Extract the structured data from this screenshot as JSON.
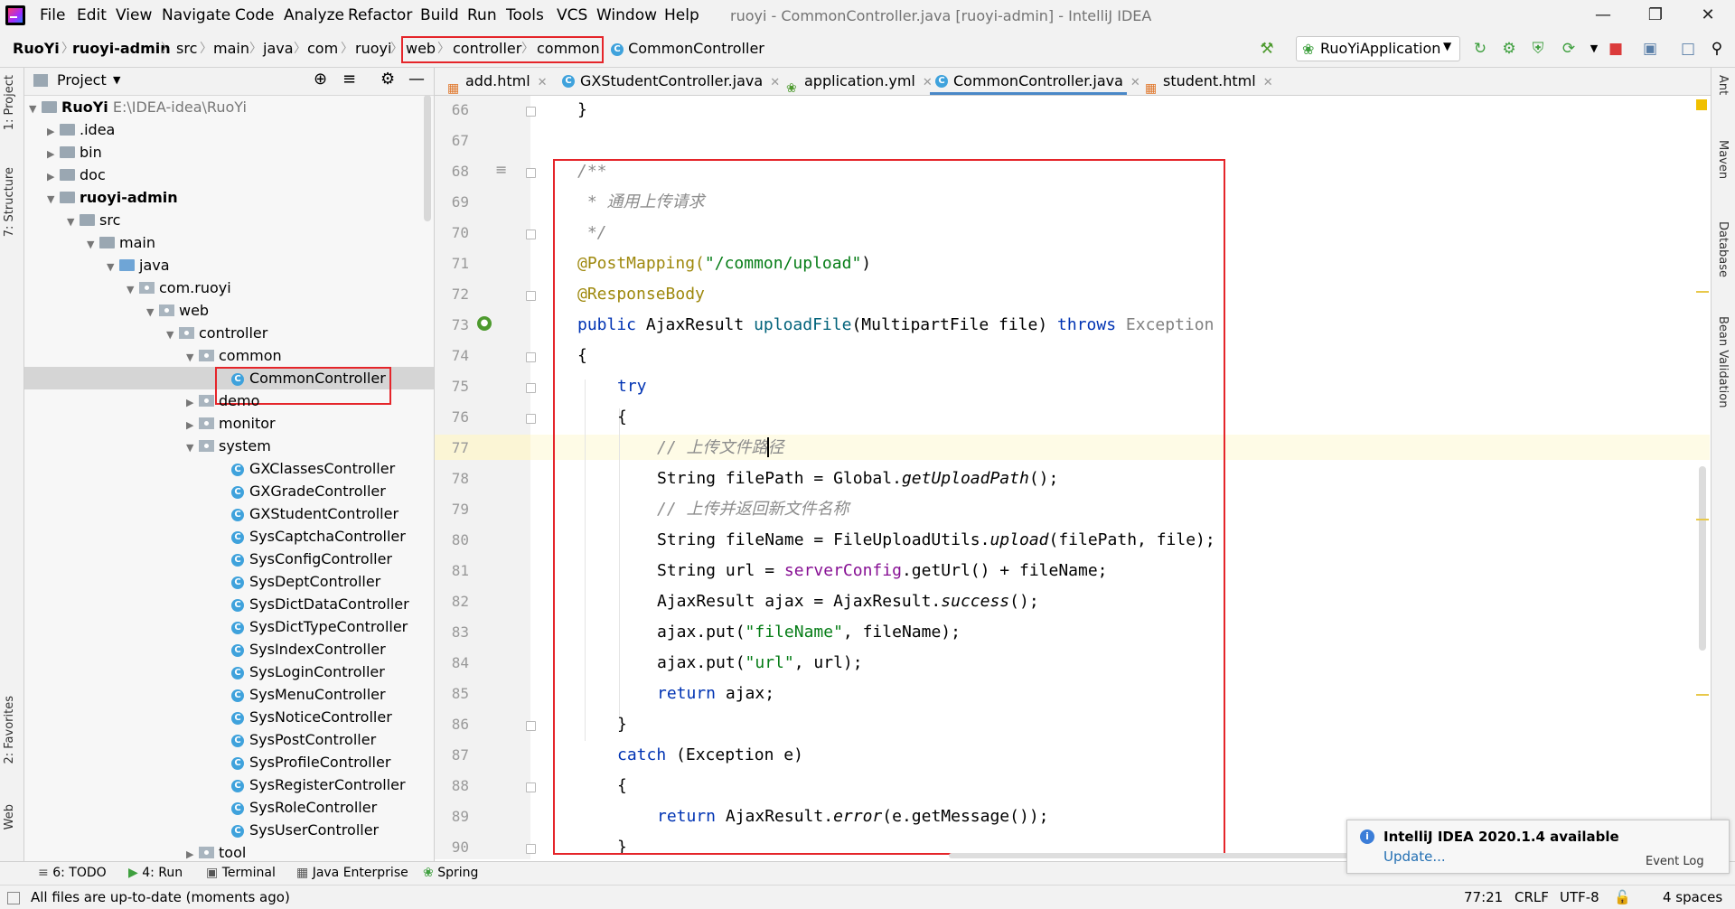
{
  "menu": [
    "File",
    "Edit",
    "View",
    "Navigate",
    "Code",
    "Analyze",
    "Refactor",
    "Build",
    "Run",
    "Tools",
    "VCS",
    "Window",
    "Help"
  ],
  "window_title": "ruoyi - CommonController.java [ruoyi-admin] - IntelliJ IDEA",
  "breadcrumbs": [
    "RuoYi",
    "ruoyi-admin",
    "src",
    "main",
    "java",
    "com",
    "ruoyi",
    "web",
    "controller",
    "common",
    "CommonController"
  ],
  "run_config": "RuoYiApplication",
  "project_panel": {
    "title": "Project"
  },
  "tree": [
    {
      "label": "RuoYi",
      "extra": "E:\\IDEA-idea\\RuoYi",
      "bold": true
    },
    {
      "label": ".idea"
    },
    {
      "label": "bin"
    },
    {
      "label": "doc"
    },
    {
      "label": "ruoyi-admin",
      "bold": true
    },
    {
      "label": "src"
    },
    {
      "label": "main"
    },
    {
      "label": "java"
    },
    {
      "label": "com.ruoyi"
    },
    {
      "label": "web"
    },
    {
      "label": "controller"
    },
    {
      "label": "common"
    },
    {
      "label": "CommonController"
    },
    {
      "label": "demo"
    },
    {
      "label": "monitor"
    },
    {
      "label": "system"
    },
    {
      "label": "GXClassesController"
    },
    {
      "label": "GXGradeController"
    },
    {
      "label": "GXStudentController"
    },
    {
      "label": "SysCaptchaController"
    },
    {
      "label": "SysConfigController"
    },
    {
      "label": "SysDeptController"
    },
    {
      "label": "SysDictDataController"
    },
    {
      "label": "SysDictTypeController"
    },
    {
      "label": "SysIndexController"
    },
    {
      "label": "SysLoginController"
    },
    {
      "label": "SysMenuController"
    },
    {
      "label": "SysNoticeController"
    },
    {
      "label": "SysPostController"
    },
    {
      "label": "SysProfileController"
    },
    {
      "label": "SysRegisterController"
    },
    {
      "label": "SysRoleController"
    },
    {
      "label": "SysUserController"
    },
    {
      "label": "tool"
    }
  ],
  "tabs": [
    "add.html",
    "GXStudentController.java",
    "application.yml",
    "CommonController.java",
    "student.html"
  ],
  "line_numbers": [
    "66",
    "67",
    "68",
    "69",
    "70",
    "71",
    "72",
    "73",
    "74",
    "75",
    "76",
    "77",
    "78",
    "79",
    "80",
    "81",
    "82",
    "83",
    "84",
    "85",
    "86",
    "87",
    "88",
    "89",
    "90"
  ],
  "code": {
    "l66": "}",
    "l68": "/**",
    "l69": " * 通用上传请求",
    "l70": " */",
    "l71a": "@PostMapping(",
    "l71b": "\"/common/upload\"",
    "l71c": ")",
    "l72": "@ResponseBody",
    "l73a": "public ",
    "l73b": "AjaxResult ",
    "l73c": "uploadFile",
    "l73d": "(MultipartFile file) ",
    "l73e": "throws ",
    "l73f": "Exception",
    "l74": "{",
    "l75": "try",
    "l76": "{",
    "l77": "// 上传文件路径",
    "l78a": "String filePath = Global.",
    "l78b": "getUploadPath",
    "l78c": "();",
    "l79": "// 上传并返回新文件名称",
    "l80a": "String fileName = FileUploadUtils.",
    "l80b": "upload",
    "l80c": "(filePath, file);",
    "l81a": "String url = ",
    "l81b": "serverConfig",
    "l81c": ".getUrl() + fileName;",
    "l82a": "AjaxResult ajax = AjaxResult.",
    "l82b": "success",
    "l82c": "();",
    "l83a": "ajax.put(",
    "l83b": "\"fileName\"",
    "l83c": ", fileName);",
    "l84a": "ajax.put(",
    "l84b": "\"url\"",
    "l84c": ", url);",
    "l85a": "return ",
    "l85b": "ajax;",
    "l86": "}",
    "l87a": "catch ",
    "l87b": "(Exception e)",
    "l88": "{",
    "l89a": "return ",
    "l89b": "AjaxResult.",
    "l89c": "error",
    "l89d": "(e.getMessage());",
    "l90": "}"
  },
  "right_tabs": [
    "Ant",
    "Maven",
    "Database",
    "Bean Validation"
  ],
  "bottom_tabs": [
    "6: TODO",
    "4: Run",
    "Terminal",
    "Java Enterprise",
    "Spring"
  ],
  "left_tabs": [
    "1: Project",
    "7: Structure",
    "2: Favorites",
    "Web"
  ],
  "status": {
    "message": "All files are up-to-date (moments ago)",
    "position": "77:21",
    "line_sep": "CRLF",
    "encoding": "UTF-8",
    "indent": "4 spaces"
  },
  "notification": {
    "title": "IntelliJ IDEA 2020.1.4 available",
    "link": "Update...",
    "event_log": "Event Log"
  },
  "colors": {
    "keyword": "#0033b3",
    "annotation": "#9e880d",
    "string": "#067d17",
    "comment": "#8c8c8c",
    "highlight_box": "#e5252a"
  }
}
